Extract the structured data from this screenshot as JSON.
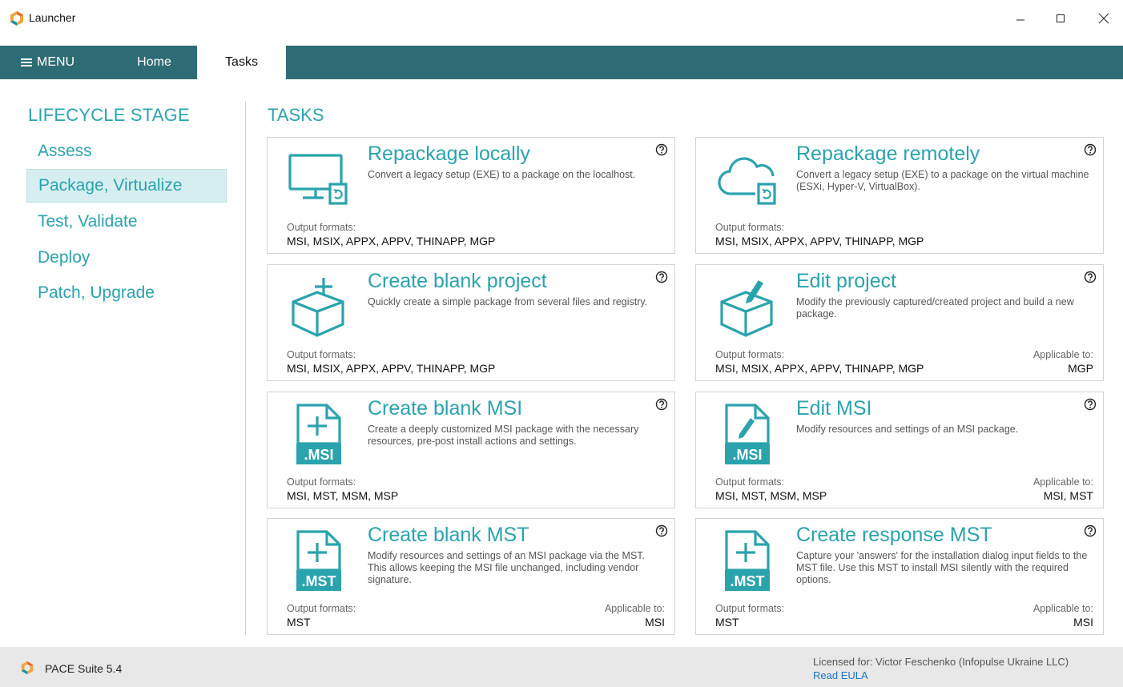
{
  "window": {
    "title": "Launcher"
  },
  "colors": {
    "accent": "#2aa3ad",
    "navbar": "#2d6c74",
    "active_bg": "#d6eef0",
    "link": "#1a73c8"
  },
  "nav": {
    "menu_label": "MENU",
    "tabs": [
      {
        "label": "Home"
      },
      {
        "label": "Tasks"
      }
    ],
    "active_tab": "Tasks"
  },
  "sidebar": {
    "title": "LIFECYCLE STAGE",
    "items": [
      {
        "label": "Assess"
      },
      {
        "label": "Package, Virtualize"
      },
      {
        "label": "Test, Validate"
      },
      {
        "label": "Deploy"
      },
      {
        "label": "Patch, Upgrade"
      }
    ],
    "active": "Package, Virtualize"
  },
  "tasks": {
    "title": "TASKS",
    "cards": [
      {
        "icon": "monitor-icon",
        "title": "Repackage locally",
        "desc": "Convert a legacy setup (EXE) to a package on the localhost.",
        "output_label": "Output formats:",
        "output": "MSI, MSIX, APPX, APPV, THINAPP, MGP",
        "applicable_label": "",
        "applicable": ""
      },
      {
        "icon": "cloud-icon",
        "title": "Repackage remotely",
        "desc": "Convert a legacy setup (EXE) to a package on the virtual machine (ESXi, Hyper-V, VirtualBox).",
        "output_label": "Output formats:",
        "output": "MSI, MSIX, APPX, APPV, THINAPP, MGP",
        "applicable_label": "",
        "applicable": ""
      },
      {
        "icon": "box-plus-icon",
        "title": "Create blank project",
        "desc": "Quickly create a simple package from several files and registry.",
        "output_label": "Output formats:",
        "output": "MSI, MSIX, APPX, APPV, THINAPP, MGP",
        "applicable_label": "",
        "applicable": ""
      },
      {
        "icon": "box-edit-icon",
        "title": "Edit project",
        "desc": "Modify the previously captured/created project and build a new package.",
        "output_label": "Output formats:",
        "output": "MSI, MSIX, APPX, APPV, THINAPP, MGP",
        "applicable_label": "Applicable to:",
        "applicable": "MGP"
      },
      {
        "icon": "msi-plus-icon",
        "title": "Create blank MSI",
        "desc": "Create a deeply customized MSI package with the necessary resources, pre-post install actions and settings.",
        "output_label": "Output formats:",
        "output": "MSI, MST, MSM, MSP",
        "applicable_label": "",
        "applicable": ""
      },
      {
        "icon": "msi-edit-icon",
        "title": "Edit MSI",
        "desc": "Modify resources and settings of an MSI package.",
        "output_label": "Output formats:",
        "output": "MSI, MST, MSM, MSP",
        "applicable_label": "Applicable to:",
        "applicable": "MSI, MST"
      },
      {
        "icon": "mst-plus-icon",
        "title": "Create blank MST",
        "desc": "Modify resources and settings of an MSI package via the MST. This allows keeping the MSI file unchanged, including vendor signature.",
        "output_label": "Output formats:",
        "output": "MST",
        "applicable_label": "Applicable to:",
        "applicable": "MSI"
      },
      {
        "icon": "mst-response-icon",
        "title": "Create response MST",
        "desc": "Capture your 'answers' for the installation dialog input fields to the MST file. Use this MST to install MSI silently with the required options.",
        "output_label": "Output formats:",
        "output": "MST",
        "applicable_label": "Applicable to:",
        "applicable": "MSI"
      }
    ]
  },
  "icon_labels": {
    "msi": ".MSI",
    "mst": ".MST"
  },
  "status": {
    "product": "PACE Suite 5.4",
    "license": "Licensed for: Victor Feschenko (Infopulse Ukraine LLC)",
    "eula": "Read EULA"
  }
}
